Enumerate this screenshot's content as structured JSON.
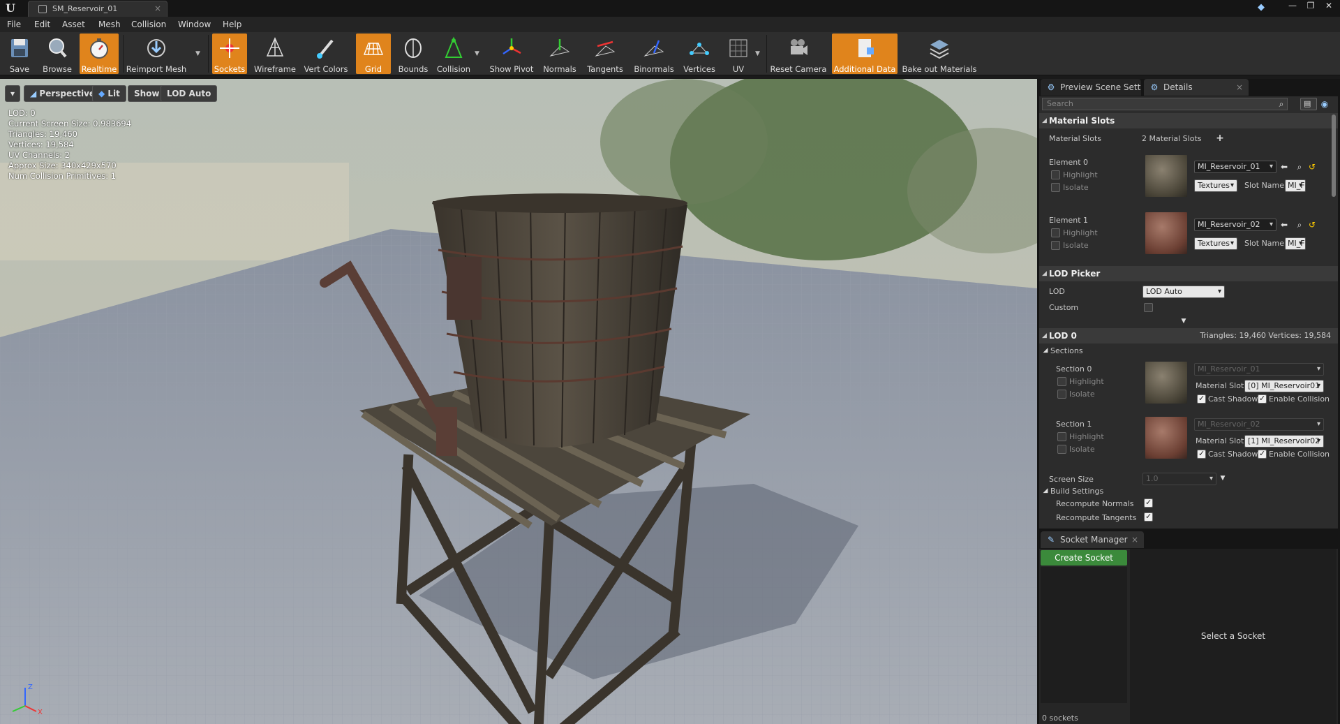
{
  "title_bar": {
    "tab_title": "SM_Reservoir_01",
    "window_controls": [
      "minimize-icon",
      "restore-icon",
      "close-icon"
    ]
  },
  "menu": [
    "File",
    "Edit",
    "Asset",
    "Mesh",
    "Collision",
    "Window",
    "Help"
  ],
  "toolbar": {
    "save": "Save",
    "browse": "Browse",
    "realtime": "Realtime",
    "reimport_mesh": "Reimport Mesh",
    "sockets": "Sockets",
    "wireframe": "Wireframe",
    "vert_colors": "Vert Colors",
    "grid": "Grid",
    "bounds": "Bounds",
    "collision": "Collision",
    "show_pivot": "Show Pivot",
    "normals": "Normals",
    "tangents": "Tangents",
    "binormals": "Binormals",
    "vertices": "Vertices",
    "uv": "UV",
    "reset_camera": "Reset Camera",
    "additional_data": "Additional Data",
    "bake_out_materials": "Bake out Materials",
    "accent_color": "#e0841c"
  },
  "viewport": {
    "perspective": "Perspective",
    "lit": "Lit",
    "show": "Show",
    "lod_auto": "LOD Auto",
    "stats": [
      "LOD:  0",
      "Current Screen Size:  0.983694",
      "Triangles:  19,460",
      "Vertices:  19,584",
      "UV Channels:  2",
      "Approx Size: 340x429x570",
      "Num Collision Primitives:  1"
    ],
    "axis_z": "Z",
    "axis_x": "X"
  },
  "panels": {
    "preview_tab": "Preview Scene Sett",
    "details_tab": "Details",
    "search_placeholder": "Search"
  },
  "material_slots": {
    "header": "Material Slots",
    "label": "Material Slots",
    "count": "2 Material Slots",
    "elements": [
      {
        "label": "Element 0",
        "highlight": "Highlight",
        "isolate": "Isolate",
        "material": "MI_Reservoir_01",
        "textures": "Textures",
        "slot_name_label": "Slot Name",
        "slot_name": "MI_F"
      },
      {
        "label": "Element 1",
        "highlight": "Highlight",
        "isolate": "Isolate",
        "material": "MI_Reservoir_02",
        "textures": "Textures",
        "slot_name_label": "Slot Name",
        "slot_name": "MI_F"
      }
    ]
  },
  "lod_picker": {
    "header": "LOD Picker",
    "lod_label": "LOD",
    "lod_value": "LOD Auto",
    "custom_label": "Custom"
  },
  "lod0": {
    "header": "LOD 0",
    "summary": "Triangles: 19,460   Vertices: 19,584",
    "sections_label": "Sections",
    "sections": [
      {
        "label": "Section 0",
        "highlight": "Highlight",
        "isolate": "Isolate",
        "material": "MI_Reservoir_01",
        "slot_label": "Material Slot",
        "slot_value": "[0] MI_Reservoir01",
        "cast_shadow": "Cast Shadow",
        "enable_collision": "Enable Collision"
      },
      {
        "label": "Section 1",
        "highlight": "Highlight",
        "isolate": "Isolate",
        "material": "MI_Reservoir_02",
        "slot_label": "Material Slot",
        "slot_value": "[1] MI_Reservoir02",
        "cast_shadow": "Cast Shadow",
        "enable_collision": "Enable Collision"
      }
    ],
    "screen_size_label": "Screen Size",
    "screen_size_value": "1.0",
    "build_settings": "Build Settings",
    "recompute_normals": "Recompute Normals",
    "recompute_tangents": "Recompute Tangents"
  },
  "socket_manager": {
    "tab": "Socket Manager",
    "create": "Create Socket",
    "count": "0 sockets",
    "hint": "Select a Socket"
  }
}
